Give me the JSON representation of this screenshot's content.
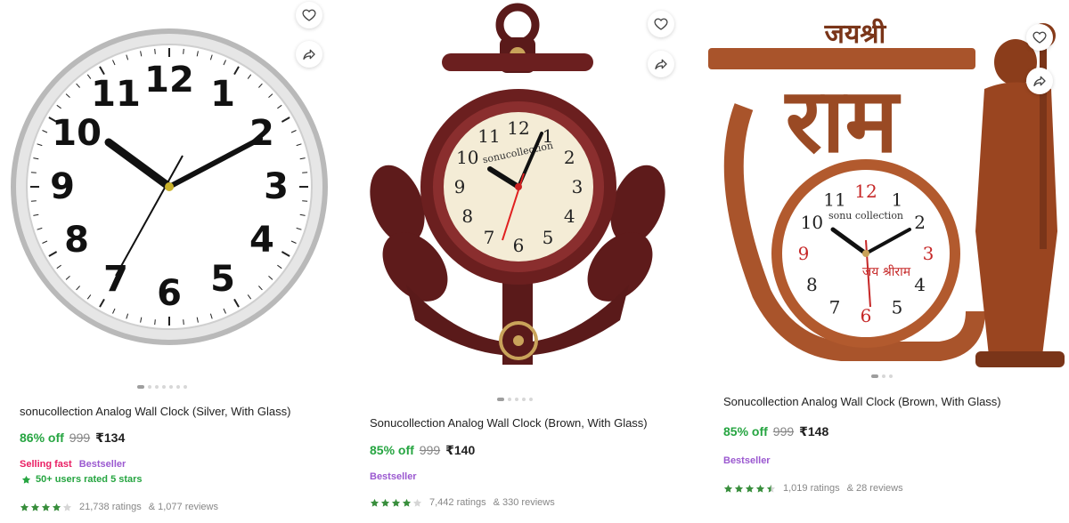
{
  "products": [
    {
      "title": "sonucollection Analog Wall Clock (Silver, With Glass)",
      "discount": "86% off",
      "mrp": "999",
      "price": "₹134",
      "badges": [
        "Selling fast",
        "Bestseller"
      ],
      "rated_text": "50+ users rated 5 stars",
      "rating_stars": 4,
      "ratings_text": "21,738 ratings",
      "reviews_text": "& 1,077 reviews",
      "image_dots": 7,
      "active_dot": 0
    },
    {
      "title": "Sonucollection Analog Wall Clock (Brown, With Glass)",
      "discount": "85% off",
      "mrp": "999",
      "price": "₹140",
      "badges": [
        "Bestseller"
      ],
      "rating_stars": 4,
      "ratings_text": "7,442 ratings",
      "reviews_text": "& 330 reviews",
      "image_dots": 5,
      "active_dot": 0,
      "clock_brand": "sonucollection"
    },
    {
      "title": "Sonucollection Analog Wall Clock (Brown, With Glass)",
      "discount": "85% off",
      "mrp": "999",
      "price": "₹148",
      "badges": [
        "Bestseller"
      ],
      "rating_stars": 4.5,
      "ratings_text": "1,019 ratings",
      "reviews_text": "& 28 reviews",
      "image_dots": 3,
      "active_dot": 0,
      "clock_brand": "sonu collection",
      "decor_text_top": "जयश्री",
      "decor_text_main": "राम",
      "dial_text": "जय श्रीराम"
    }
  ],
  "clock_numbers": [
    "12",
    "1",
    "2",
    "3",
    "4",
    "5",
    "6",
    "7",
    "8",
    "9",
    "10",
    "11"
  ],
  "icons": {
    "wishlist": "heart-icon",
    "share": "share-icon",
    "rated": "star-badge-icon"
  },
  "colors": {
    "discount": "#26a541",
    "rating_star": "#388e3c",
    "selling_fast": "#e91e63",
    "bestseller": "#9b59d0",
    "wood": "#6b1f1f",
    "wood_light": "#a9542b"
  }
}
